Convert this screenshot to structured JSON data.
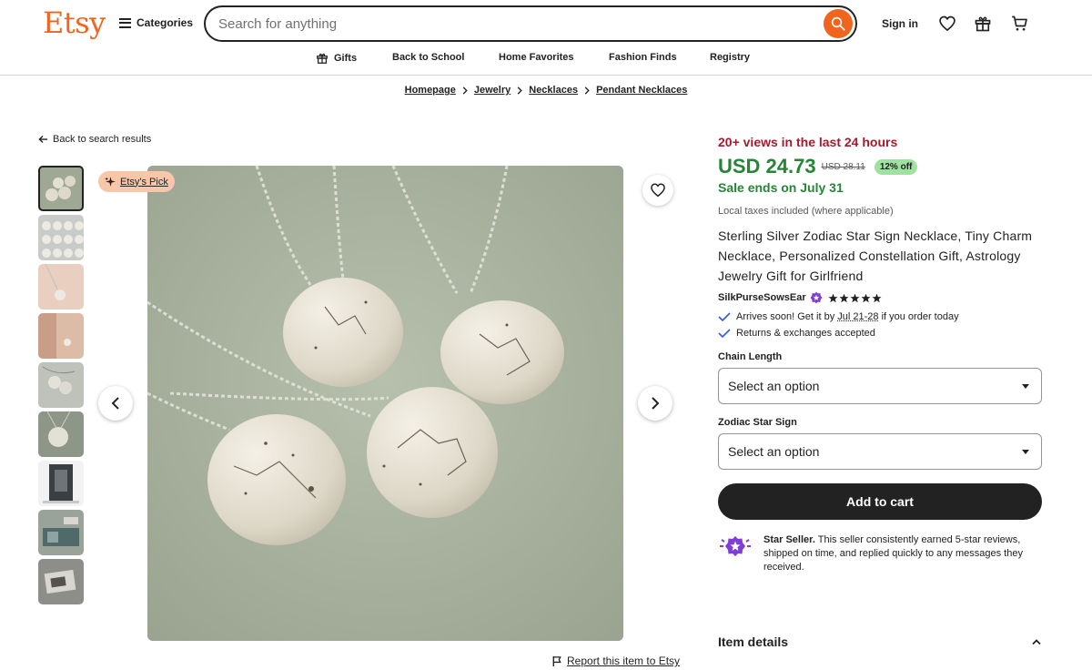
{
  "header": {
    "logo": "Etsy",
    "categories_label": "Categories",
    "search_placeholder": "Search for anything",
    "signin_label": "Sign in"
  },
  "nav": {
    "items": [
      "Gifts",
      "Back to School",
      "Home Favorites",
      "Fashion Finds",
      "Registry"
    ]
  },
  "breadcrumb": [
    "Homepage",
    "Jewelry",
    "Necklaces",
    "Pendant Necklaces"
  ],
  "gallery": {
    "back_label": "Back to search results",
    "badge_label": "Etsy's Pick",
    "report_label": "Report this item to Etsy"
  },
  "product": {
    "views": "20+ views in the last 24 hours",
    "price": "USD 24.73",
    "original_price": "USD 28.11",
    "discount": "12% off",
    "sale_ends": "Sale ends on July 31",
    "taxes": "Local taxes included (where applicable)",
    "title": "Sterling Silver Zodiac Star Sign Necklace, Tiny Charm Necklace, Personalized Constellation Gift, Astrology Jewelry Gift for Girlfriend",
    "seller": "SilkPurseSowsEar",
    "rating": 5,
    "arrival_prefix": "Arrives soon! Get it by ",
    "arrival_date": "Jul 21-28",
    "arrival_suffix": " if you order today",
    "returns": "Returns & exchanges accepted",
    "chain_length_label": "Chain Length",
    "chain_length_value": "Select an option",
    "zodiac_label": "Zodiac Star Sign",
    "zodiac_value": "Select an option",
    "add_to_cart": "Add to cart",
    "star_seller_title": "Star Seller.",
    "star_seller_text": " This seller consistently earned 5-star reviews, shipped on time, and replied quickly to any messages they received.",
    "item_details": "Item details"
  },
  "colors": {
    "brand": "#f1641e",
    "price_green": "#258635",
    "views_red": "#a61a2e",
    "discount_badge": "#9ee29f",
    "star_seller_purple": "#7f3fd6"
  }
}
